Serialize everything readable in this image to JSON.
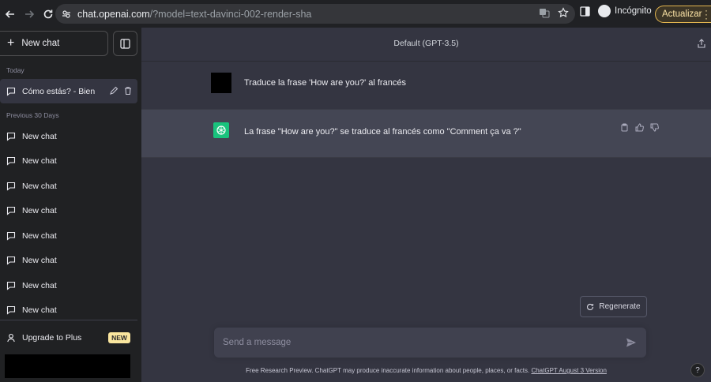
{
  "browser": {
    "url_host": "chat.openai.com",
    "url_path": "/?model=text-davinci-002-render-sha",
    "profile_label": "Incógnito",
    "update_label": "Actualizar"
  },
  "sidebar": {
    "new_chat_label": "New chat",
    "today_label": "Today",
    "active_chat": "Cómo estás? - Bien",
    "previous_label": "Previous 30 Days",
    "previous_chats": [
      "New chat",
      "New chat",
      "New chat",
      "New chat",
      "New chat",
      "New chat",
      "New chat",
      "New chat"
    ],
    "upgrade_label": "Upgrade to Plus",
    "new_badge": "NEW"
  },
  "main": {
    "model_title": "Default (GPT-3.5)",
    "user_message": "Traduce la frase 'How are you?' al francés",
    "bot_message": "La frase \"How are you?\" se traduce al francés como \"Comment ça va ?\"",
    "regenerate_label": "Regenerate",
    "input_placeholder": "Send a message",
    "footer_text": "Free Research Preview. ChatGPT may produce inaccurate information about people, places, or facts. ",
    "footer_link": "ChatGPT August 3 Version",
    "help_label": "?"
  },
  "colors": {
    "sidebar_bg": "#202123",
    "main_bg": "#343541",
    "bot_bg": "#444654",
    "accent": "#19c37d",
    "badge": "#fae69e"
  }
}
